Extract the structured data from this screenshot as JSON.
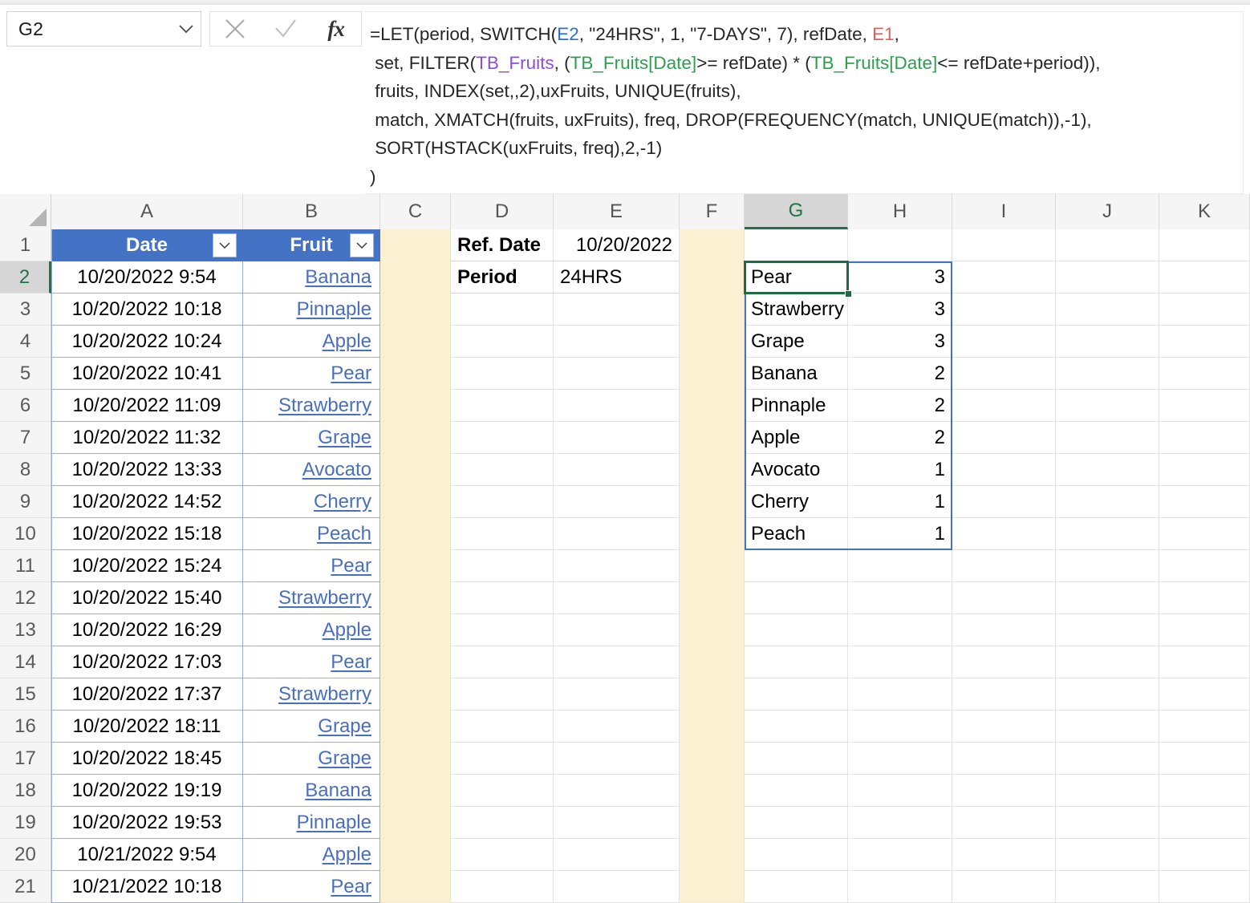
{
  "app": "excel-grid",
  "namebox": {
    "value": "G2",
    "icon": "chevron-down-icon"
  },
  "formula_buttons": {
    "cancel": "cancel-icon",
    "enter": "check-icon",
    "insert_function": "fx"
  },
  "formula": {
    "full": "=LET(period, SWITCH(E2, \"24HRS\", 1, \"7-DAYS\", 7), refDate, E1,\n set, FILTER(TB_Fruits, (TB_Fruits[Date]>= refDate) * (TB_Fruits[Date]<= refDate+period)),\n fruits, INDEX(set,,2),uxFruits, UNIQUE(fruits),\n match, XMATCH(fruits, uxFruits), freq, DROP(FREQUENCY(match, UNIQUE(match)),-1),\n SORT(HSTACK(uxFruits, freq),2,-1)\n)",
    "lines": [
      {
        "parts": [
          {
            "t": "=LET(period, SWITCH(",
            "c": "plain"
          },
          {
            "t": "E2",
            "c": "ref"
          },
          {
            "t": ", \"24HRS\", 1, \"7-DAYS\", 7), refDate, ",
            "c": "plain"
          },
          {
            "t": "E1",
            "c": "ref2"
          },
          {
            "t": ",",
            "c": "plain"
          }
        ]
      },
      {
        "parts": [
          {
            "t": " set, FILTER(",
            "c": "plain"
          },
          {
            "t": "TB_Fruits",
            "c": "tbl"
          },
          {
            "t": ", (",
            "c": "plain"
          },
          {
            "t": "TB_Fruits[Date]",
            "c": "col"
          },
          {
            "t": ">= refDate) * (",
            "c": "plain"
          },
          {
            "t": "TB_Fruits[Date]",
            "c": "col"
          },
          {
            "t": "<= refDate+period)),",
            "c": "plain"
          }
        ]
      },
      {
        "parts": [
          {
            "t": " fruits, INDEX(set,,2),uxFruits, UNIQUE(fruits),",
            "c": "plain"
          }
        ]
      },
      {
        "parts": [
          {
            "t": " match, XMATCH(fruits, uxFruits), freq, DROP(FREQUENCY(match, UNIQUE(match)),-1),",
            "c": "plain"
          }
        ]
      },
      {
        "parts": [
          {
            "t": " SORT(HSTACK(uxFruits, freq),2,-1)",
            "c": "plain"
          }
        ]
      },
      {
        "parts": [
          {
            "t": ")",
            "c": "plain"
          }
        ]
      }
    ]
  },
  "grid": {
    "columns": [
      "A",
      "B",
      "C",
      "D",
      "E",
      "F",
      "G",
      "H",
      "I",
      "J",
      "K"
    ],
    "selected_column": "G",
    "rows": [
      "1",
      "2",
      "3",
      "4",
      "5",
      "6",
      "7",
      "8",
      "9",
      "10",
      "11",
      "12",
      "13",
      "14",
      "15",
      "16",
      "17",
      "18",
      "19",
      "20",
      "21"
    ],
    "selected_row": "2",
    "beige_columns": [
      "C",
      "F"
    ],
    "accent_table_header": "#4472C4",
    "accent_selection": "#217346",
    "accent_spill": "#4472C4",
    "beige_fill": "#FBF0D2"
  },
  "table": {
    "name": "TB_Fruits",
    "headers": [
      "Date",
      "Fruit"
    ],
    "filter_icon": "chevron-down-icon",
    "rows": [
      {
        "date": "10/20/2022 9:54",
        "fruit": "Banana"
      },
      {
        "date": "10/20/2022 10:18",
        "fruit": "Pinnaple"
      },
      {
        "date": "10/20/2022 10:24",
        "fruit": "Apple"
      },
      {
        "date": "10/20/2022 10:41",
        "fruit": "Pear"
      },
      {
        "date": "10/20/2022 11:09",
        "fruit": "Strawberry"
      },
      {
        "date": "10/20/2022 11:32",
        "fruit": "Grape"
      },
      {
        "date": "10/20/2022 13:33",
        "fruit": "Avocato"
      },
      {
        "date": "10/20/2022 14:52",
        "fruit": "Cherry"
      },
      {
        "date": "10/20/2022 15:18",
        "fruit": "Peach"
      },
      {
        "date": "10/20/2022 15:24",
        "fruit": "Pear"
      },
      {
        "date": "10/20/2022 15:40",
        "fruit": "Strawberry"
      },
      {
        "date": "10/20/2022 16:29",
        "fruit": "Apple"
      },
      {
        "date": "10/20/2022 17:03",
        "fruit": "Pear"
      },
      {
        "date": "10/20/2022 17:37",
        "fruit": "Strawberry"
      },
      {
        "date": "10/20/2022 18:11",
        "fruit": "Grape"
      },
      {
        "date": "10/20/2022 18:45",
        "fruit": "Grape"
      },
      {
        "date": "10/20/2022 19:19",
        "fruit": "Banana"
      },
      {
        "date": "10/20/2022 19:53",
        "fruit": "Pinnaple"
      },
      {
        "date": "10/21/2022 9:54",
        "fruit": "Apple"
      },
      {
        "date": "10/21/2022 10:18",
        "fruit": "Pear"
      }
    ]
  },
  "parameters": [
    {
      "label": "Ref. Date",
      "value": "10/20/2022"
    },
    {
      "label": "Period",
      "value": "24HRS"
    }
  ],
  "results": {
    "active_cell": "G2",
    "spill_range": "G2:H10",
    "rows": [
      {
        "fruit": "Pear",
        "count": "3"
      },
      {
        "fruit": "Strawberry",
        "count": "3"
      },
      {
        "fruit": "Grape",
        "count": "3"
      },
      {
        "fruit": "Banana",
        "count": "2"
      },
      {
        "fruit": "Pinnaple",
        "count": "2"
      },
      {
        "fruit": "Apple",
        "count": "2"
      },
      {
        "fruit": "Avocato",
        "count": "1"
      },
      {
        "fruit": "Cherry",
        "count": "1"
      },
      {
        "fruit": "Peach",
        "count": "1"
      }
    ]
  }
}
